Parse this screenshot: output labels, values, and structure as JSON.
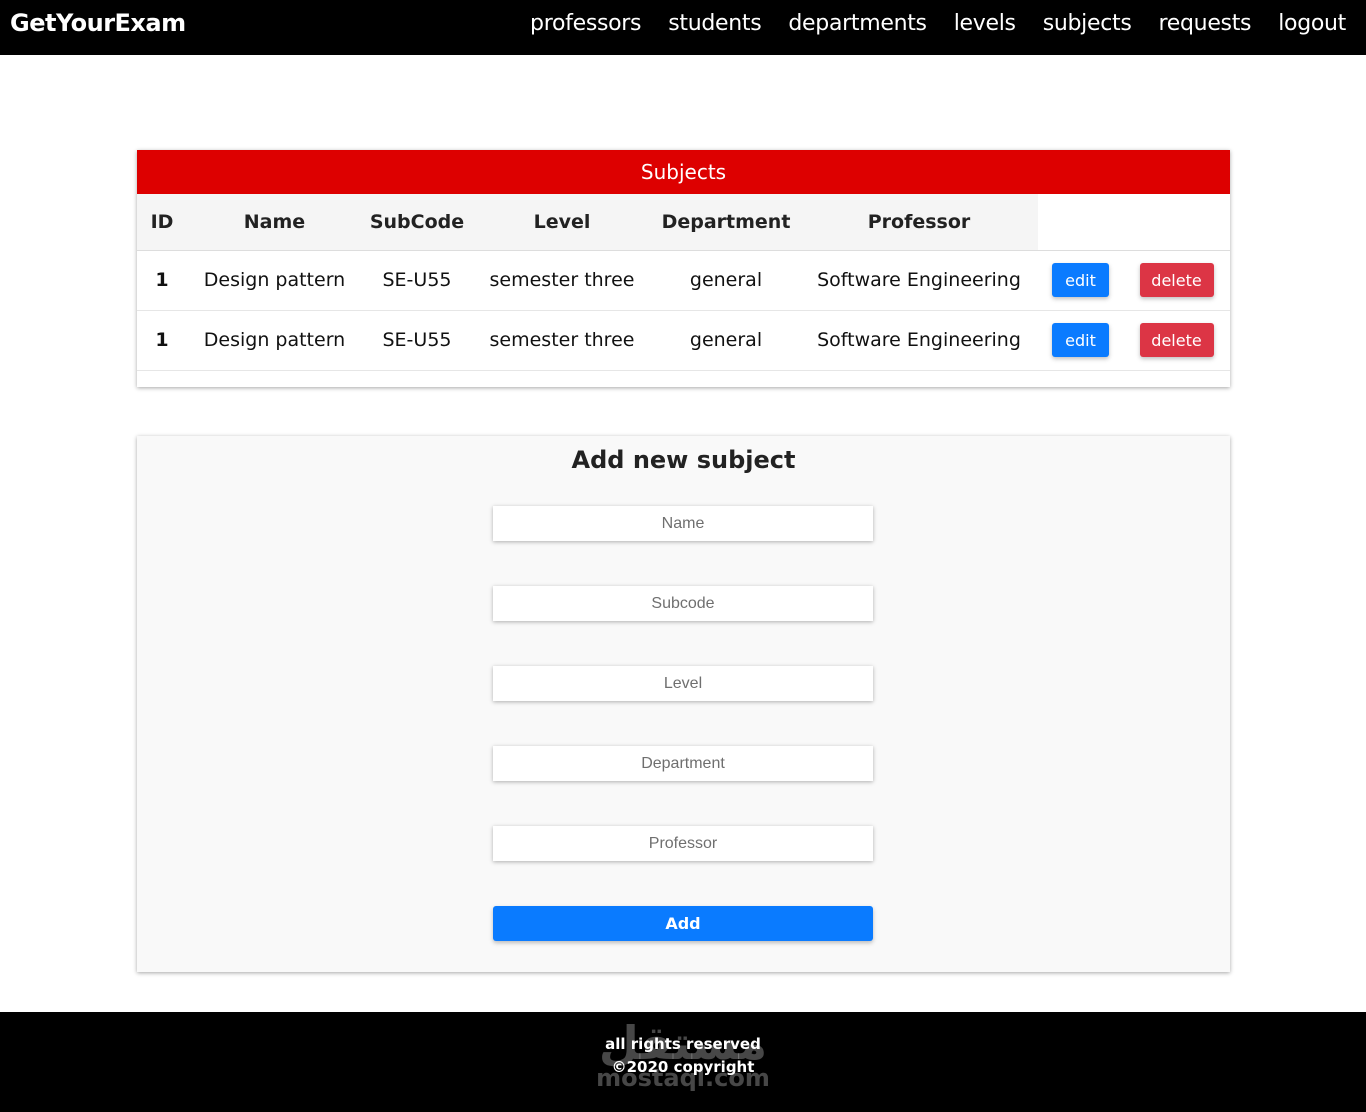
{
  "navbar": {
    "brand": "GetYourExam",
    "links": [
      "professors",
      "students",
      "departments",
      "levels",
      "subjects",
      "requests",
      "logout"
    ]
  },
  "subjects_table": {
    "title": "Subjects",
    "headers": [
      "ID",
      "Name",
      "SubCode",
      "Level",
      "Department",
      "Professor"
    ],
    "rows": [
      {
        "id": "1",
        "name": "Design pattern",
        "subcode": "SE-U55",
        "level": "semester three",
        "department": "general",
        "professor": "Software Engineering"
      },
      {
        "id": "1",
        "name": "Design pattern",
        "subcode": "SE-U55",
        "level": "semester three",
        "department": "general",
        "professor": "Software Engineering"
      }
    ],
    "edit_label": "edit",
    "delete_label": "delete"
  },
  "add_form": {
    "title": "Add new subject",
    "placeholders": {
      "name": "Name",
      "subcode": "Subcode",
      "level": "Level",
      "department": "Department",
      "professor": "Professor"
    },
    "submit_label": "Add"
  },
  "footer": {
    "line1": "all rights reserved",
    "line2": "©2020 copyright",
    "watermark_ar": "مستقل",
    "watermark_lat": "mostaql.com"
  },
  "colors": {
    "navbar_bg": "#000000",
    "table_header_bg": "#dd0000",
    "primary": "#0a7bff",
    "danger": "#dc3545"
  }
}
